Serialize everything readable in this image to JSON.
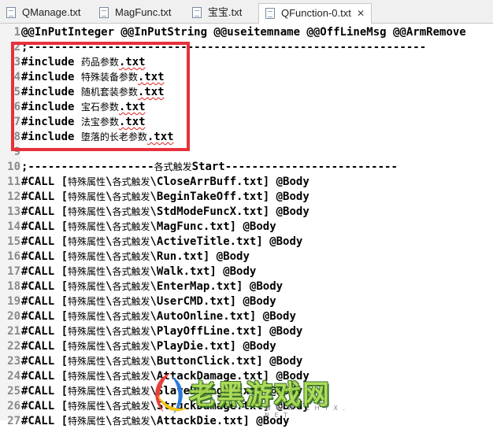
{
  "tabs": [
    {
      "label": "QManage.txt",
      "active": false
    },
    {
      "label": "MagFunc.txt",
      "active": false
    },
    {
      "label": "宝宝.txt",
      "active": false
    },
    {
      "label": "QFunction-0.txt",
      "active": true
    }
  ],
  "tab_close_glyph": "✕",
  "lines": [
    {
      "num": "1",
      "parts": [
        {
          "t": "@@InPutInteger @@InPutString @@useitemname @@OffLineMsg @@ArmRemove"
        }
      ]
    },
    {
      "num": "2",
      "parts": [
        {
          "t": ";------------------------------------------------------------"
        }
      ]
    },
    {
      "num": "3",
      "parts": [
        {
          "t": "#include "
        },
        {
          "t": "药品参数",
          "cjk": true
        },
        {
          "t": ".txt",
          "squig": true
        }
      ]
    },
    {
      "num": "4",
      "parts": [
        {
          "t": "#include "
        },
        {
          "t": "特殊装备参数",
          "cjk": true
        },
        {
          "t": ".txt",
          "squig": true
        }
      ]
    },
    {
      "num": "5",
      "parts": [
        {
          "t": "#include "
        },
        {
          "t": "随机套装参数",
          "cjk": true
        },
        {
          "t": ".txt",
          "squig": true
        }
      ]
    },
    {
      "num": "6",
      "parts": [
        {
          "t": "#include "
        },
        {
          "t": "宝石参数",
          "cjk": true
        },
        {
          "t": ".txt",
          "squig": true
        }
      ]
    },
    {
      "num": "7",
      "parts": [
        {
          "t": "#include "
        },
        {
          "t": "法宝参数",
          "cjk": true
        },
        {
          "t": ".txt",
          "squig": true
        }
      ]
    },
    {
      "num": "8",
      "parts": [
        {
          "t": "#include "
        },
        {
          "t": "堕落的长老参数",
          "cjk": true
        },
        {
          "t": ".txt",
          "squig": true
        }
      ]
    },
    {
      "num": "9",
      "parts": [
        {
          "t": ""
        }
      ]
    },
    {
      "num": "10",
      "parts": [
        {
          "t": ";-------------------"
        },
        {
          "t": "各式触发",
          "cjk": true
        },
        {
          "t": "Start--------------------------"
        }
      ]
    },
    {
      "num": "11",
      "parts": [
        {
          "t": "#CALL ["
        },
        {
          "t": "特殊属性",
          "cjk": true
        },
        {
          "t": "\\"
        },
        {
          "t": "各式触发",
          "cjk": true
        },
        {
          "t": "\\CloseArrBuff.txt] @Body"
        }
      ]
    },
    {
      "num": "12",
      "parts": [
        {
          "t": "#CALL ["
        },
        {
          "t": "特殊属性",
          "cjk": true
        },
        {
          "t": "\\"
        },
        {
          "t": "各式触发",
          "cjk": true
        },
        {
          "t": "\\BeginTakeOff.txt] @Body"
        }
      ]
    },
    {
      "num": "13",
      "parts": [
        {
          "t": "#CALL ["
        },
        {
          "t": "特殊属性",
          "cjk": true
        },
        {
          "t": "\\"
        },
        {
          "t": "各式触发",
          "cjk": true
        },
        {
          "t": "\\StdModeFuncX.txt] @Body"
        }
      ]
    },
    {
      "num": "14",
      "parts": [
        {
          "t": "#CALL ["
        },
        {
          "t": "特殊属性",
          "cjk": true
        },
        {
          "t": "\\"
        },
        {
          "t": "各式触发",
          "cjk": true
        },
        {
          "t": "\\MagFunc.txt] @Body"
        }
      ]
    },
    {
      "num": "15",
      "parts": [
        {
          "t": "#CALL ["
        },
        {
          "t": "特殊属性",
          "cjk": true
        },
        {
          "t": "\\"
        },
        {
          "t": "各式触发",
          "cjk": true
        },
        {
          "t": "\\ActiveTitle.txt] @Body"
        }
      ]
    },
    {
      "num": "16",
      "parts": [
        {
          "t": "#CALL ["
        },
        {
          "t": "特殊属性",
          "cjk": true
        },
        {
          "t": "\\"
        },
        {
          "t": "各式触发",
          "cjk": true
        },
        {
          "t": "\\Run.txt] @Body"
        }
      ]
    },
    {
      "num": "17",
      "parts": [
        {
          "t": "#CALL ["
        },
        {
          "t": "特殊属性",
          "cjk": true
        },
        {
          "t": "\\"
        },
        {
          "t": "各式触发",
          "cjk": true
        },
        {
          "t": "\\Walk.txt] @Body"
        }
      ]
    },
    {
      "num": "18",
      "parts": [
        {
          "t": "#CALL ["
        },
        {
          "t": "特殊属性",
          "cjk": true
        },
        {
          "t": "\\"
        },
        {
          "t": "各式触发",
          "cjk": true
        },
        {
          "t": "\\EnterMap.txt] @Body"
        }
      ]
    },
    {
      "num": "19",
      "parts": [
        {
          "t": "#CALL ["
        },
        {
          "t": "特殊属性",
          "cjk": true
        },
        {
          "t": "\\"
        },
        {
          "t": "各式触发",
          "cjk": true
        },
        {
          "t": "\\UserCMD.txt] @Body"
        }
      ]
    },
    {
      "num": "20",
      "parts": [
        {
          "t": "#CALL ["
        },
        {
          "t": "特殊属性",
          "cjk": true
        },
        {
          "t": "\\"
        },
        {
          "t": "各式触发",
          "cjk": true
        },
        {
          "t": "\\AutoOnline.txt] @Body"
        }
      ]
    },
    {
      "num": "21",
      "parts": [
        {
          "t": "#CALL ["
        },
        {
          "t": "特殊属性",
          "cjk": true
        },
        {
          "t": "\\"
        },
        {
          "t": "各式触发",
          "cjk": true
        },
        {
          "t": "\\PlayOffLine.txt] @Body"
        }
      ]
    },
    {
      "num": "22",
      "parts": [
        {
          "t": "#CALL ["
        },
        {
          "t": "特殊属性",
          "cjk": true
        },
        {
          "t": "\\"
        },
        {
          "t": "各式触发",
          "cjk": true
        },
        {
          "t": "\\PlayDie.txt] @Body"
        }
      ]
    },
    {
      "num": "23",
      "parts": [
        {
          "t": "#CALL ["
        },
        {
          "t": "特殊属性",
          "cjk": true
        },
        {
          "t": "\\"
        },
        {
          "t": "各式触发",
          "cjk": true
        },
        {
          "t": "\\ButtonClick.txt] @Body"
        }
      ]
    },
    {
      "num": "24",
      "parts": [
        {
          "t": "#CALL ["
        },
        {
          "t": "特殊属性",
          "cjk": true
        },
        {
          "t": "\\"
        },
        {
          "t": "各式触发",
          "cjk": true
        },
        {
          "t": "\\AttackDamage.txt] @Body"
        }
      ]
    },
    {
      "num": "25",
      "parts": [
        {
          "t": "#CALL ["
        },
        {
          "t": "特殊属性",
          "cjk": true
        },
        {
          "t": "\\"
        },
        {
          "t": "各式触发",
          "cjk": true
        },
        {
          "t": "\\SlaveDamage.txt] @Body"
        }
      ]
    },
    {
      "num": "26",
      "parts": [
        {
          "t": "#CALL ["
        },
        {
          "t": "特殊属性",
          "cjk": true
        },
        {
          "t": "\\"
        },
        {
          "t": "各式触发",
          "cjk": true
        },
        {
          "t": "\\StruckDamage.txt] @Body"
        }
      ]
    },
    {
      "num": "27",
      "parts": [
        {
          "t": "#CALL ["
        },
        {
          "t": "特殊属性",
          "cjk": true
        },
        {
          "t": "\\"
        },
        {
          "t": "各式触发",
          "cjk": true
        },
        {
          "t": "\\AttackDie.txt] @Body"
        }
      ]
    }
  ],
  "watermark": {
    "text": "老黑游戏网",
    "sub": "W W W . L H Y X . N E T"
  },
  "colors": {
    "highlight_border": "#e8303a",
    "gutter_bg": "#f3f3f3",
    "line_number": "#8a8a8a"
  }
}
